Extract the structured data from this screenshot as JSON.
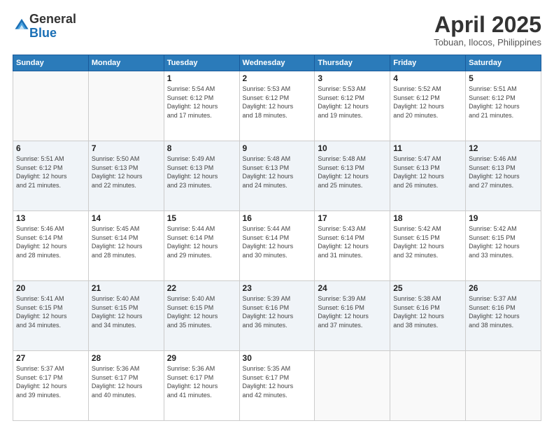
{
  "logo": {
    "general": "General",
    "blue": "Blue"
  },
  "header": {
    "month": "April 2025",
    "location": "Tobuan, Ilocos, Philippines"
  },
  "weekdays": [
    "Sunday",
    "Monday",
    "Tuesday",
    "Wednesday",
    "Thursday",
    "Friday",
    "Saturday"
  ],
  "weeks": [
    [
      {
        "day": "",
        "info": ""
      },
      {
        "day": "",
        "info": ""
      },
      {
        "day": "1",
        "info": "Sunrise: 5:54 AM\nSunset: 6:12 PM\nDaylight: 12 hours\nand 17 minutes."
      },
      {
        "day": "2",
        "info": "Sunrise: 5:53 AM\nSunset: 6:12 PM\nDaylight: 12 hours\nand 18 minutes."
      },
      {
        "day": "3",
        "info": "Sunrise: 5:53 AM\nSunset: 6:12 PM\nDaylight: 12 hours\nand 19 minutes."
      },
      {
        "day": "4",
        "info": "Sunrise: 5:52 AM\nSunset: 6:12 PM\nDaylight: 12 hours\nand 20 minutes."
      },
      {
        "day": "5",
        "info": "Sunrise: 5:51 AM\nSunset: 6:12 PM\nDaylight: 12 hours\nand 21 minutes."
      }
    ],
    [
      {
        "day": "6",
        "info": "Sunrise: 5:51 AM\nSunset: 6:12 PM\nDaylight: 12 hours\nand 21 minutes."
      },
      {
        "day": "7",
        "info": "Sunrise: 5:50 AM\nSunset: 6:13 PM\nDaylight: 12 hours\nand 22 minutes."
      },
      {
        "day": "8",
        "info": "Sunrise: 5:49 AM\nSunset: 6:13 PM\nDaylight: 12 hours\nand 23 minutes."
      },
      {
        "day": "9",
        "info": "Sunrise: 5:48 AM\nSunset: 6:13 PM\nDaylight: 12 hours\nand 24 minutes."
      },
      {
        "day": "10",
        "info": "Sunrise: 5:48 AM\nSunset: 6:13 PM\nDaylight: 12 hours\nand 25 minutes."
      },
      {
        "day": "11",
        "info": "Sunrise: 5:47 AM\nSunset: 6:13 PM\nDaylight: 12 hours\nand 26 minutes."
      },
      {
        "day": "12",
        "info": "Sunrise: 5:46 AM\nSunset: 6:13 PM\nDaylight: 12 hours\nand 27 minutes."
      }
    ],
    [
      {
        "day": "13",
        "info": "Sunrise: 5:46 AM\nSunset: 6:14 PM\nDaylight: 12 hours\nand 28 minutes."
      },
      {
        "day": "14",
        "info": "Sunrise: 5:45 AM\nSunset: 6:14 PM\nDaylight: 12 hours\nand 28 minutes."
      },
      {
        "day": "15",
        "info": "Sunrise: 5:44 AM\nSunset: 6:14 PM\nDaylight: 12 hours\nand 29 minutes."
      },
      {
        "day": "16",
        "info": "Sunrise: 5:44 AM\nSunset: 6:14 PM\nDaylight: 12 hours\nand 30 minutes."
      },
      {
        "day": "17",
        "info": "Sunrise: 5:43 AM\nSunset: 6:14 PM\nDaylight: 12 hours\nand 31 minutes."
      },
      {
        "day": "18",
        "info": "Sunrise: 5:42 AM\nSunset: 6:15 PM\nDaylight: 12 hours\nand 32 minutes."
      },
      {
        "day": "19",
        "info": "Sunrise: 5:42 AM\nSunset: 6:15 PM\nDaylight: 12 hours\nand 33 minutes."
      }
    ],
    [
      {
        "day": "20",
        "info": "Sunrise: 5:41 AM\nSunset: 6:15 PM\nDaylight: 12 hours\nand 34 minutes."
      },
      {
        "day": "21",
        "info": "Sunrise: 5:40 AM\nSunset: 6:15 PM\nDaylight: 12 hours\nand 34 minutes."
      },
      {
        "day": "22",
        "info": "Sunrise: 5:40 AM\nSunset: 6:15 PM\nDaylight: 12 hours\nand 35 minutes."
      },
      {
        "day": "23",
        "info": "Sunrise: 5:39 AM\nSunset: 6:16 PM\nDaylight: 12 hours\nand 36 minutes."
      },
      {
        "day": "24",
        "info": "Sunrise: 5:39 AM\nSunset: 6:16 PM\nDaylight: 12 hours\nand 37 minutes."
      },
      {
        "day": "25",
        "info": "Sunrise: 5:38 AM\nSunset: 6:16 PM\nDaylight: 12 hours\nand 38 minutes."
      },
      {
        "day": "26",
        "info": "Sunrise: 5:37 AM\nSunset: 6:16 PM\nDaylight: 12 hours\nand 38 minutes."
      }
    ],
    [
      {
        "day": "27",
        "info": "Sunrise: 5:37 AM\nSunset: 6:17 PM\nDaylight: 12 hours\nand 39 minutes."
      },
      {
        "day": "28",
        "info": "Sunrise: 5:36 AM\nSunset: 6:17 PM\nDaylight: 12 hours\nand 40 minutes."
      },
      {
        "day": "29",
        "info": "Sunrise: 5:36 AM\nSunset: 6:17 PM\nDaylight: 12 hours\nand 41 minutes."
      },
      {
        "day": "30",
        "info": "Sunrise: 5:35 AM\nSunset: 6:17 PM\nDaylight: 12 hours\nand 42 minutes."
      },
      {
        "day": "",
        "info": ""
      },
      {
        "day": "",
        "info": ""
      },
      {
        "day": "",
        "info": ""
      }
    ]
  ]
}
